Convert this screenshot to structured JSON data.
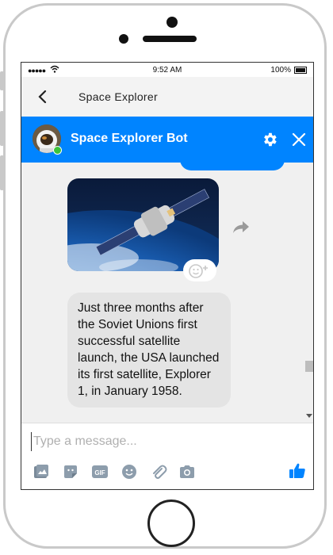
{
  "status_bar": {
    "signal": "●●●●●",
    "time": "9:52 AM",
    "battery": "100%"
  },
  "nav": {
    "title": "Space Explorer"
  },
  "bot_header": {
    "title": "Space Explorer Bot",
    "online_color": "#3cc43c"
  },
  "chat": {
    "message_text": "Just three months after the Soviet Unions first successful satellite launch, the USA launched its first satellite, Explorer 1, in January 1958."
  },
  "composer": {
    "placeholder": "Type a message..."
  },
  "colors": {
    "accent": "#0084ff",
    "bubble_grey": "#e4e4e4",
    "chat_background": "#f0f0f0"
  },
  "icons": [
    "back-arrow-icon",
    "gear-icon",
    "close-icon",
    "share-icon",
    "add-reaction-icon",
    "photo-icon",
    "sticker-icon",
    "gif-icon",
    "emoji-icon",
    "attachment-icon",
    "camera-icon",
    "thumbs-up-icon"
  ]
}
